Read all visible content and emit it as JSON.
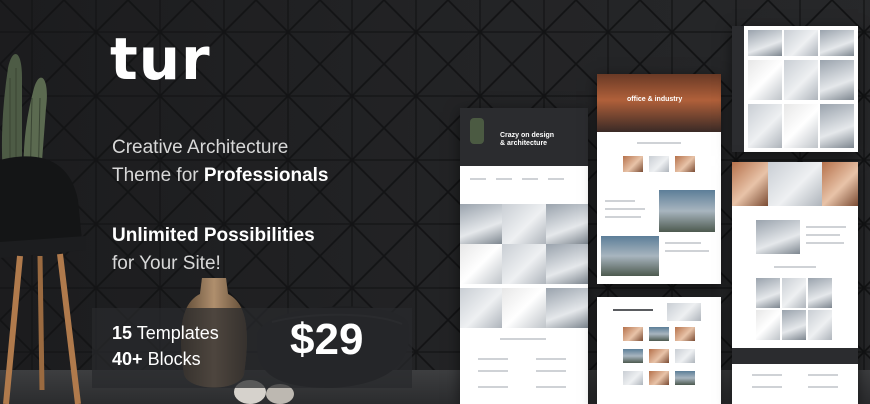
{
  "brand": {
    "logo": "tur"
  },
  "tagline": {
    "line1": "Creative Architecture",
    "line2_prefix": "Theme for ",
    "line2_bold": "Professionals"
  },
  "features": {
    "line1": "Unlimited Possibilities",
    "line2": "for Your Site!"
  },
  "stats": {
    "templates_count": "15",
    "templates_label": "Templates",
    "blocks_count": "40+",
    "blocks_label": "Blocks"
  },
  "price": "$29",
  "screens": {
    "s1_hero_line1": "Crazy on design",
    "s1_hero_line2": "& architecture",
    "s2_hero": "office & industry"
  },
  "colors": {
    "background": "#2a2b2d",
    "text": "#ffffff",
    "muted_text": "#d8d8d8"
  }
}
